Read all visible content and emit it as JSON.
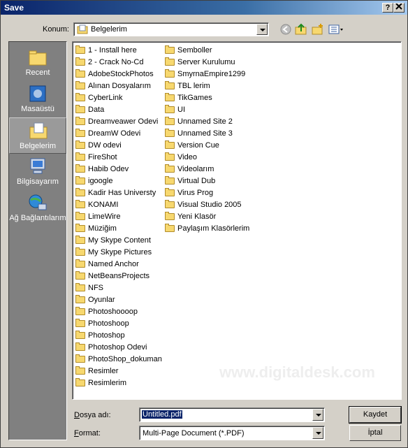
{
  "window": {
    "title": "Save",
    "help_btn": "?",
    "close_btn": "X"
  },
  "location": {
    "label": "Konum:",
    "value": "Belgelerim"
  },
  "places": [
    {
      "label": "Recent",
      "icon": "recent-folder-icon"
    },
    {
      "label": "Masaüstü",
      "icon": "desktop-icon"
    },
    {
      "label": "Belgelerim",
      "icon": "my-documents-icon",
      "selected": true
    },
    {
      "label": "Bilgisayarım",
      "icon": "my-computer-icon"
    },
    {
      "label": "Ağ Bağlantılarım",
      "icon": "network-places-icon"
    }
  ],
  "files_col1": [
    "1 - Install here",
    "2 - Crack No-Cd",
    "AdobeStockPhotos",
    "Alınan Dosyalarım",
    "CyberLink",
    "Data",
    "Dreamveawer Odevi",
    "DreamW Odevi",
    "DW odevi",
    "FireShot",
    "Habib Odev",
    "igoogle",
    "Kadir Has Universty",
    "KONAMI",
    "LimeWire",
    "Müziğim",
    "My Skype Content",
    "My Skype Pictures",
    "Named Anchor",
    "NetBeansProjects",
    "NFS",
    "Oyunlar",
    "Photoshoooop",
    "Photoshoop",
    "Photoshop",
    "Photoshop Odevi",
    "PhotoShop_dokuman",
    "Resimler",
    "Resimlerim"
  ],
  "files_col2": [
    "Semboller",
    "Server Kurulumu",
    "SmyrnaEmpire1299",
    "TBL lerim",
    "TikGames",
    "UI",
    "Unnamed Site 2",
    "Unnamed Site 3",
    "Version Cue",
    "Video",
    "Videolarım",
    "Virtual Dub",
    "Virus Prog",
    "Visual Studio 2005",
    "Yeni Klasör",
    "Paylaşım Klasörlerim"
  ],
  "filename": {
    "label": "Dosya adı:",
    "value": "Untitled.pdf"
  },
  "format": {
    "label": "Format:",
    "value": "Multi-Page Document (*.PDF)"
  },
  "buttons": {
    "save": "Kaydet",
    "cancel": "İptal"
  },
  "watermark": "www.digitaldesk.com"
}
